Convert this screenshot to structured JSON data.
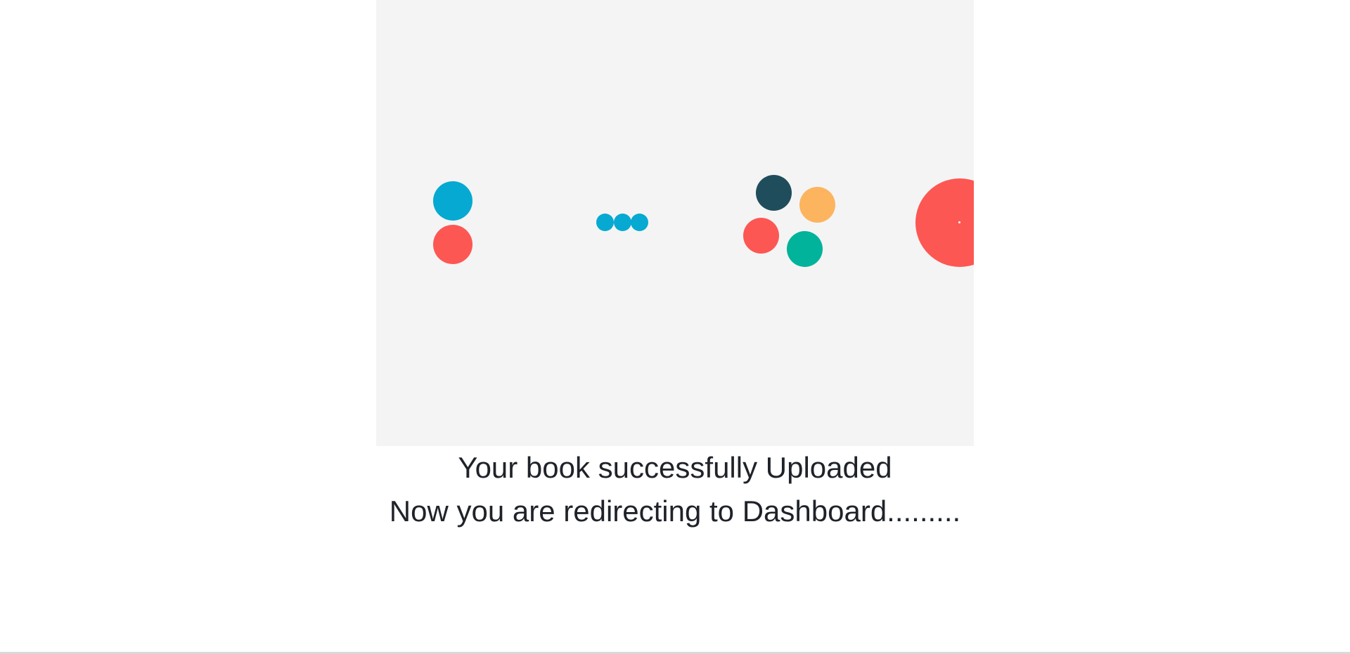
{
  "message": {
    "line1": "Your book successfully Uploaded",
    "line2": "Now you are redirecting to Dashboard........."
  },
  "colors": {
    "panel_background": "#f4f4f4",
    "blue": "#06a9d1",
    "red": "#fd5753",
    "dark_teal": "#1f4d5c",
    "orange": "#fdb45f",
    "green": "#00b39a",
    "text": "#1f2329"
  },
  "loaders": [
    {
      "name": "two-dots-spinner-icon"
    },
    {
      "name": "three-dots-spinner-icon"
    },
    {
      "name": "four-dots-spinner-icon"
    },
    {
      "name": "pulse-circle-spinner-icon"
    }
  ]
}
